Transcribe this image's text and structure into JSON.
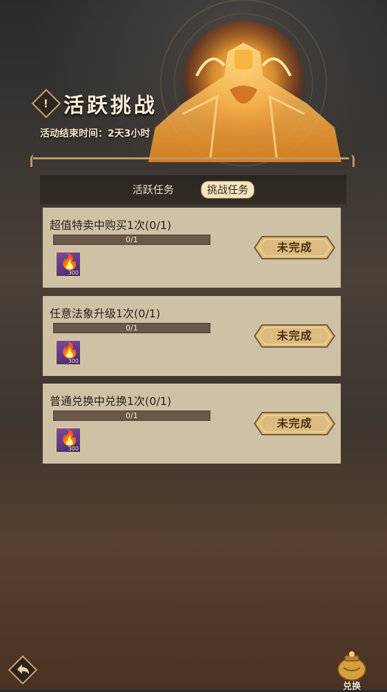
{
  "header": {
    "title": "活跃挑战",
    "badge_glyph": "!",
    "end_time": "活动结束时间：2天3小时"
  },
  "tabs": [
    {
      "label": "活跃任务",
      "active": false
    },
    {
      "label": "挑战任务",
      "active": true
    }
  ],
  "tasks": [
    {
      "title": "超值特卖中购买1次(0/1)",
      "progress_text": "0/1",
      "progress": 0,
      "reward_icon": "flame-icon",
      "reward_qty": "300",
      "status": "未完成"
    },
    {
      "title": "任意法象升级1次(0/1)",
      "progress_text": "0/1",
      "progress": 0,
      "reward_icon": "flame-icon",
      "reward_qty": "300",
      "status": "未完成"
    },
    {
      "title": "普通兑换中兑换1次(0/1)",
      "progress_text": "0/1",
      "progress": 0,
      "reward_icon": "flame-icon",
      "reward_qty": "300",
      "status": "未完成"
    }
  ],
  "footer": {
    "back_icon": "back-arrow-icon",
    "exchange_label": "兑换",
    "exchange_icon": "treasure-pot-icon"
  },
  "colors": {
    "accent_gold": "#c9a36a",
    "card_bg": "#cfc1a6",
    "button_gold": "#d9b97a"
  }
}
